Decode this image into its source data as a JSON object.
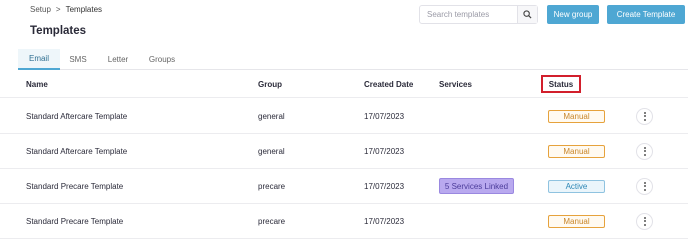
{
  "breadcrumb": {
    "parent": "Setup",
    "separator": ">",
    "current": "Templates"
  },
  "page": {
    "title": "Templates"
  },
  "search": {
    "placeholder": "Search templates",
    "icon": "search-icon"
  },
  "actions": {
    "new_group": "New group",
    "create_template": "Create Template"
  },
  "tabs": [
    {
      "label": "Email",
      "active": true
    },
    {
      "label": "SMS",
      "active": false
    },
    {
      "label": "Letter",
      "active": false
    },
    {
      "label": "Groups",
      "active": false
    }
  ],
  "table": {
    "headers": {
      "name": "Name",
      "group": "Group",
      "created": "Created Date",
      "services": "Services",
      "status": "Status"
    },
    "rows": [
      {
        "name": "Standard Aftercare Template",
        "group": "general",
        "created": "17/07/2023",
        "services": "",
        "status": "Manual"
      },
      {
        "name": "Standard Aftercare Template",
        "group": "general",
        "created": "17/07/2023",
        "services": "",
        "status": "Manual"
      },
      {
        "name": "Standard Precare Template",
        "group": "precare",
        "created": "17/07/2023",
        "services": "5 Services Linked",
        "status": "Active"
      },
      {
        "name": "Standard Precare Template",
        "group": "precare",
        "created": "17/07/2023",
        "services": "",
        "status": "Manual"
      }
    ]
  },
  "colors": {
    "primary_button": "#4ea7d3",
    "manual_badge": "#e6a23c",
    "active_badge": "#2d87b5",
    "services_badge": "#b9a9ef",
    "highlight_box": "#d21f2c"
  }
}
